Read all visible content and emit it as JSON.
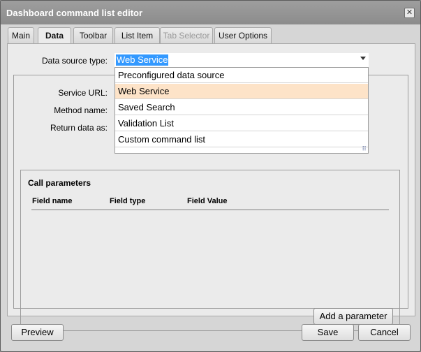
{
  "window": {
    "title": "Dashboard command list editor",
    "close_glyph": "✕"
  },
  "tabs": [
    {
      "label": "Main",
      "state": "normal"
    },
    {
      "label": "Data",
      "state": "active"
    },
    {
      "label": "Toolbar",
      "state": "normal"
    },
    {
      "label": "List Item",
      "state": "normal"
    },
    {
      "label": "Tab Selector",
      "state": "disabled"
    },
    {
      "label": "User Options",
      "state": "normal"
    }
  ],
  "data_tab": {
    "data_source_label": "Data source type:",
    "data_source_value": "Web Service",
    "service_url_label": "Service URL:",
    "method_name_label": "Method name:",
    "return_data_label": "Return data as:",
    "call_parameters": {
      "title": "Call parameters",
      "columns": [
        "Field name",
        "Field type",
        "Field Value"
      ],
      "add_button_label": "Add a parameter"
    }
  },
  "dropdown": {
    "options": [
      "Preconfigured data source",
      "Web Service",
      "Saved Search",
      "Validation List",
      "Custom command list"
    ],
    "selected_index": 1
  },
  "footer": {
    "preview_label": "Preview",
    "save_label": "Save",
    "cancel_label": "Cancel"
  },
  "colors": {
    "selection_highlight": "#3399ff",
    "dropdown_selected": "#fde3c8"
  }
}
